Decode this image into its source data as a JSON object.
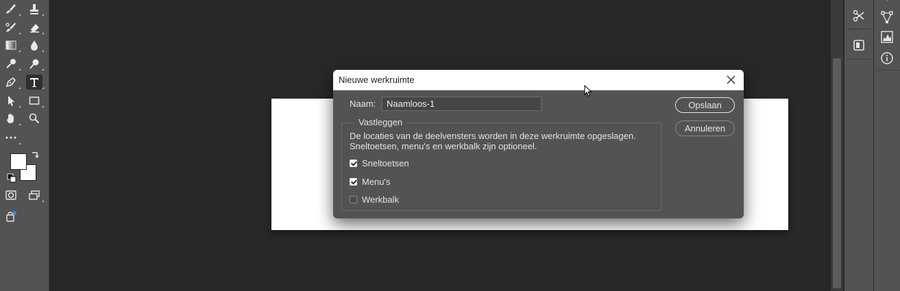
{
  "dialog": {
    "title": "Nieuwe werkruimte",
    "name_label": "Naam:",
    "name_value": "Naamloos-1",
    "group_title": "Vastleggen",
    "description": "De locaties van de deelvensters worden in deze werkruimte opgeslagen. Sneltoetsen, menu's en werkbalk zijn optioneel.",
    "options": [
      {
        "label": "Sneltoetsen",
        "checked": true
      },
      {
        "label": "Menu's",
        "checked": true
      },
      {
        "label": "Werkbalk",
        "checked": false
      }
    ],
    "save_label": "Opslaan",
    "cancel_label": "Annuleren"
  },
  "toolbar": {
    "tools": [
      "brush-icon",
      "stamp-icon",
      "history-brush-icon",
      "eraser-icon",
      "gradient-icon",
      "blur-icon",
      "dodge-icon",
      "burn-icon",
      "pen-icon",
      "type-icon",
      "path-selection-icon",
      "rectangle-icon",
      "hand-icon",
      "zoom-icon",
      "more-icon",
      "quick-mask-icon",
      "screen-mode-icon",
      "generative-icon"
    ],
    "active_tool": "type-icon",
    "foreground_color": "#ffffff",
    "background_color": "#ffffff"
  },
  "panels": {
    "icons": [
      "tools-icon",
      "library-icon",
      "path-icon",
      "histogram-icon",
      "info-icon"
    ]
  },
  "colors": {
    "app_bg": "#282828",
    "panel_bg": "#535353",
    "dialog_bg": "#535353",
    "accent_white": "#ffffff"
  }
}
